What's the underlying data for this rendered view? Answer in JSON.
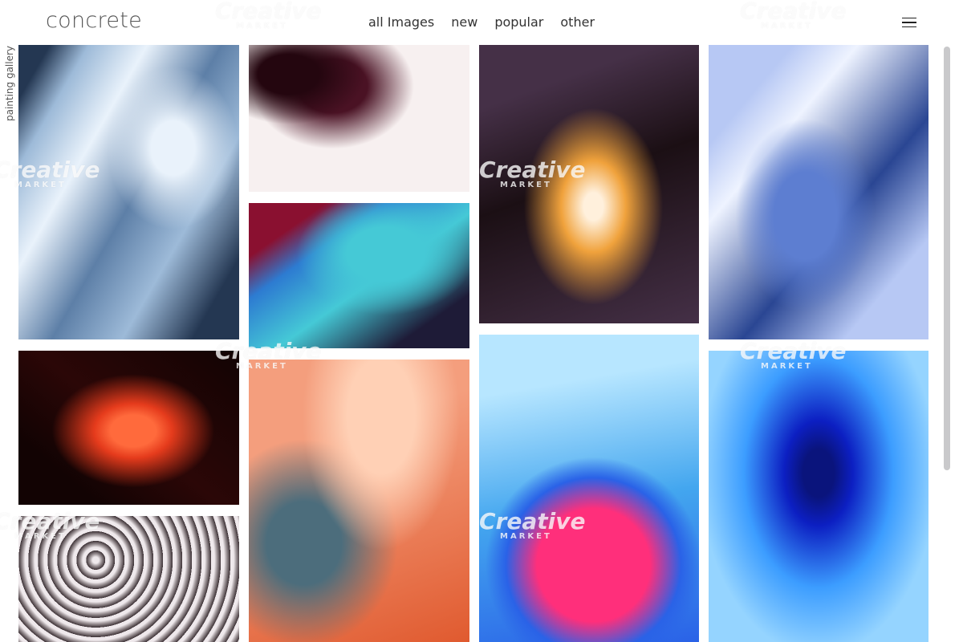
{
  "header": {
    "logo": "concrete",
    "nav": [
      "all Images",
      "new",
      "popular",
      "other"
    ],
    "menu_icon": "hamburger-menu-icon"
  },
  "sidebar": {
    "label": "painting gallery"
  },
  "watermark": {
    "line1": "Creative",
    "line2": "MARKET"
  },
  "gallery": {
    "tiles": [
      {
        "name": "blue-marble-ice",
        "colors": [
          "#9dbad8",
          "#5d7fa7",
          "#e9f2fb",
          "#243752"
        ]
      },
      {
        "name": "pink-ink-drops",
        "colors": [
          "#f7f0f0",
          "#e4b8c0",
          "#4a1224",
          "#24060f"
        ]
      },
      {
        "name": "teal-red-marble",
        "colors": [
          "#45c9d6",
          "#8a1030",
          "#2d7bd1",
          "#1e1b37"
        ]
      },
      {
        "name": "red-flame-marble",
        "colors": [
          "#2b0707",
          "#e53b1c",
          "#ff6a3c",
          "#120303"
        ]
      },
      {
        "name": "pink-orange-clouds",
        "colors": [
          "#f49e7d",
          "#4c6d7c",
          "#ffd0b5",
          "#e05a2f"
        ]
      },
      {
        "name": "grey-waves-marble",
        "colors": [
          "#a79ea1",
          "#3b3034",
          "#efe9ec",
          "#1f1a1d"
        ]
      },
      {
        "name": "gold-swirl-dark",
        "colors": [
          "#1b0f14",
          "#f0a23c",
          "#fff0dc",
          "#453047"
        ]
      },
      {
        "name": "blue-pink-geode",
        "colors": [
          "#43a6ef",
          "#ff2f7b",
          "#2a62e7",
          "#b7e6ff"
        ]
      },
      {
        "name": "periwinkle-ice-marble",
        "colors": [
          "#b7c8f4",
          "#5d7ed1",
          "#eef3ff",
          "#2a4693"
        ]
      },
      {
        "name": "blue-vortex-ink",
        "colors": [
          "#3c9dff",
          "#0c1fc2",
          "#95d4ff",
          "#0a147c"
        ]
      }
    ]
  }
}
